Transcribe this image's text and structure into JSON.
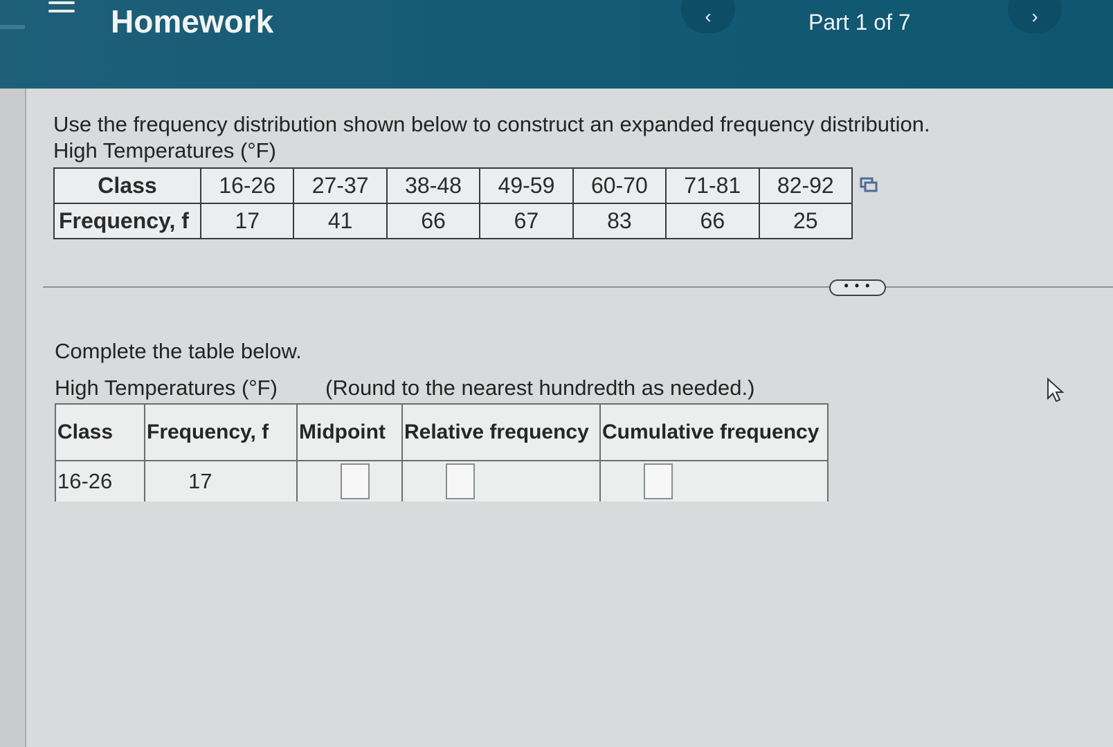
{
  "header": {
    "title": "Homework",
    "part_label": "Part 1 of 7",
    "prev_icon": "chevron-left-icon",
    "next_icon": "chevron-right-icon",
    "menu_icon": "hamburger-menu-icon"
  },
  "question": {
    "instruction": "Use the frequency distribution shown below to construct an expanded frequency distribution.",
    "table_title": "High Temperatures (°F)",
    "row_labels": {
      "class": "Class",
      "frequency": "Frequency, f"
    },
    "classes": [
      "16-26",
      "27-37",
      "38-48",
      "49-59",
      "60-70",
      "71-81",
      "82-92"
    ],
    "frequencies": [
      "17",
      "41",
      "66",
      "67",
      "83",
      "66",
      "25"
    ]
  },
  "answer": {
    "complete_prompt": "Complete the table below.",
    "table_title": "High Temperatures (°F)",
    "round_note": "(Round to the nearest hundredth as needed.)",
    "columns": [
      "Class",
      "Frequency, f",
      "Midpoint",
      "Relative frequency",
      "Cumulative frequency"
    ],
    "first_row": {
      "class": "16-26",
      "frequency": "17"
    }
  },
  "more_button_label": "• • •",
  "colors": {
    "header_bg": "#145a75",
    "page_bg": "#d9dadb"
  }
}
